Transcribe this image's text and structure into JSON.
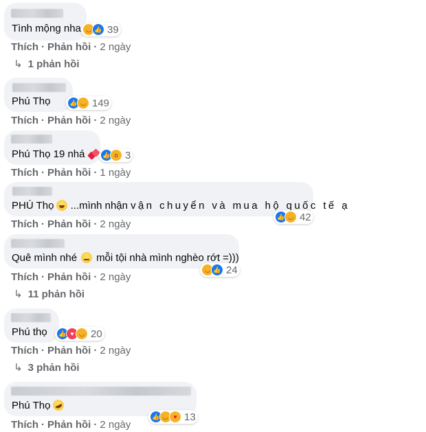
{
  "labels": {
    "like": "Thích",
    "reply": "Phản hồi",
    "dot": "·"
  },
  "comments": [
    {
      "text": "Tình mộng nha",
      "reactions": {
        "icons": [
          "haha",
          "like"
        ],
        "count": "39"
      },
      "time": "2 ngày",
      "replies": "1 phản hồi"
    },
    {
      "text": "Phú Thọ",
      "reactions": {
        "icons": [
          "like",
          "haha"
        ],
        "count": "149"
      },
      "time": "2 ngày",
      "replies": null
    },
    {
      "text": "Phú Thọ 19 nhá",
      "text_emoji": "two-hearts-emoji",
      "reactions": {
        "icons": [
          "like",
          "wow"
        ],
        "count": "3"
      },
      "time": "1 ngày",
      "replies": null
    },
    {
      "text_a": "PHÚ Thọ",
      "text_b": "...mình nhận",
      "text_c": "vận chuyển và mua hộ quốc tế ạ",
      "text_emoji": "grinning-sweat-emoji",
      "reactions": {
        "icons": [
          "like",
          "haha"
        ],
        "count": "42"
      },
      "time": "2 ngày",
      "replies": null
    },
    {
      "text_a": "Quê mình nhé",
      "text_b": "mỗi tội nhà mình nghèo rớt =)))",
      "text_emoji": "downcast-sweat-emoji",
      "reactions": {
        "icons": [
          "haha",
          "like"
        ],
        "count": "24"
      },
      "time": "2 ngày",
      "replies": "11 phản hồi"
    },
    {
      "text": "Phú thọ",
      "reactions": {
        "icons": [
          "like",
          "love",
          "haha"
        ],
        "count": "20"
      },
      "time": "2 ngày",
      "replies": "3 phản hồi"
    },
    {
      "text": "Phú Thọ",
      "text_emoji": "rofl-emoji",
      "reactions": {
        "icons": [
          "like",
          "haha",
          "care"
        ],
        "count": "13"
      },
      "time": "2 ngày",
      "replies": null
    }
  ],
  "colors": {
    "bubble": "#f0f2f5",
    "meta": "#65676b",
    "like": "#1877f2",
    "love": "#f33e58",
    "haha": "#f7b125"
  }
}
